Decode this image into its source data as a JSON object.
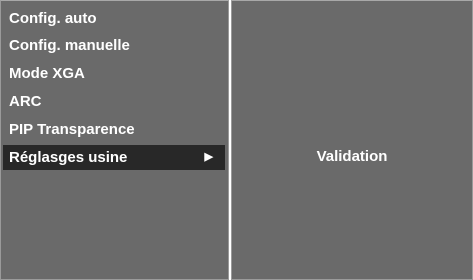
{
  "menu": {
    "items": [
      {
        "label": "Config. auto",
        "selected": false
      },
      {
        "label": "Config. manuelle",
        "selected": false
      },
      {
        "label": "Mode XGA",
        "selected": false
      },
      {
        "label": "ARC",
        "selected": false
      },
      {
        "label": "PIP Transparence",
        "selected": false
      },
      {
        "label": "Réglasges usine",
        "selected": true,
        "has_submenu": true
      }
    ],
    "submenu_arrow_icon": "play-arrow-icon"
  },
  "detail": {
    "label": "Validation"
  },
  "colors": {
    "panel_background": "#6a6a6a",
    "selected_background": "#282828",
    "text": "#ffffff"
  }
}
